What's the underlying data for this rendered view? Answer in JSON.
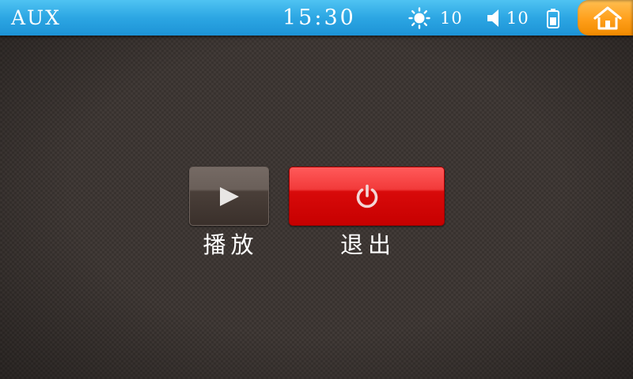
{
  "header": {
    "source_label": "AUX",
    "time": "15:30",
    "brightness": {
      "icon": "brightness-icon",
      "value": "10"
    },
    "volume": {
      "icon": "volume-icon",
      "value": "10"
    },
    "battery": {
      "icon": "battery-icon"
    },
    "home": {
      "icon": "home-icon"
    }
  },
  "controls": {
    "play": {
      "icon": "play-icon",
      "label": "播放"
    },
    "exit": {
      "icon": "power-icon",
      "label": "退出"
    }
  },
  "colors": {
    "header": "#2ca6e3",
    "home_button": "#ff9f1a",
    "exit_button": "#d80a0a",
    "play_button": "#5a4f49",
    "background": "#413a37"
  }
}
